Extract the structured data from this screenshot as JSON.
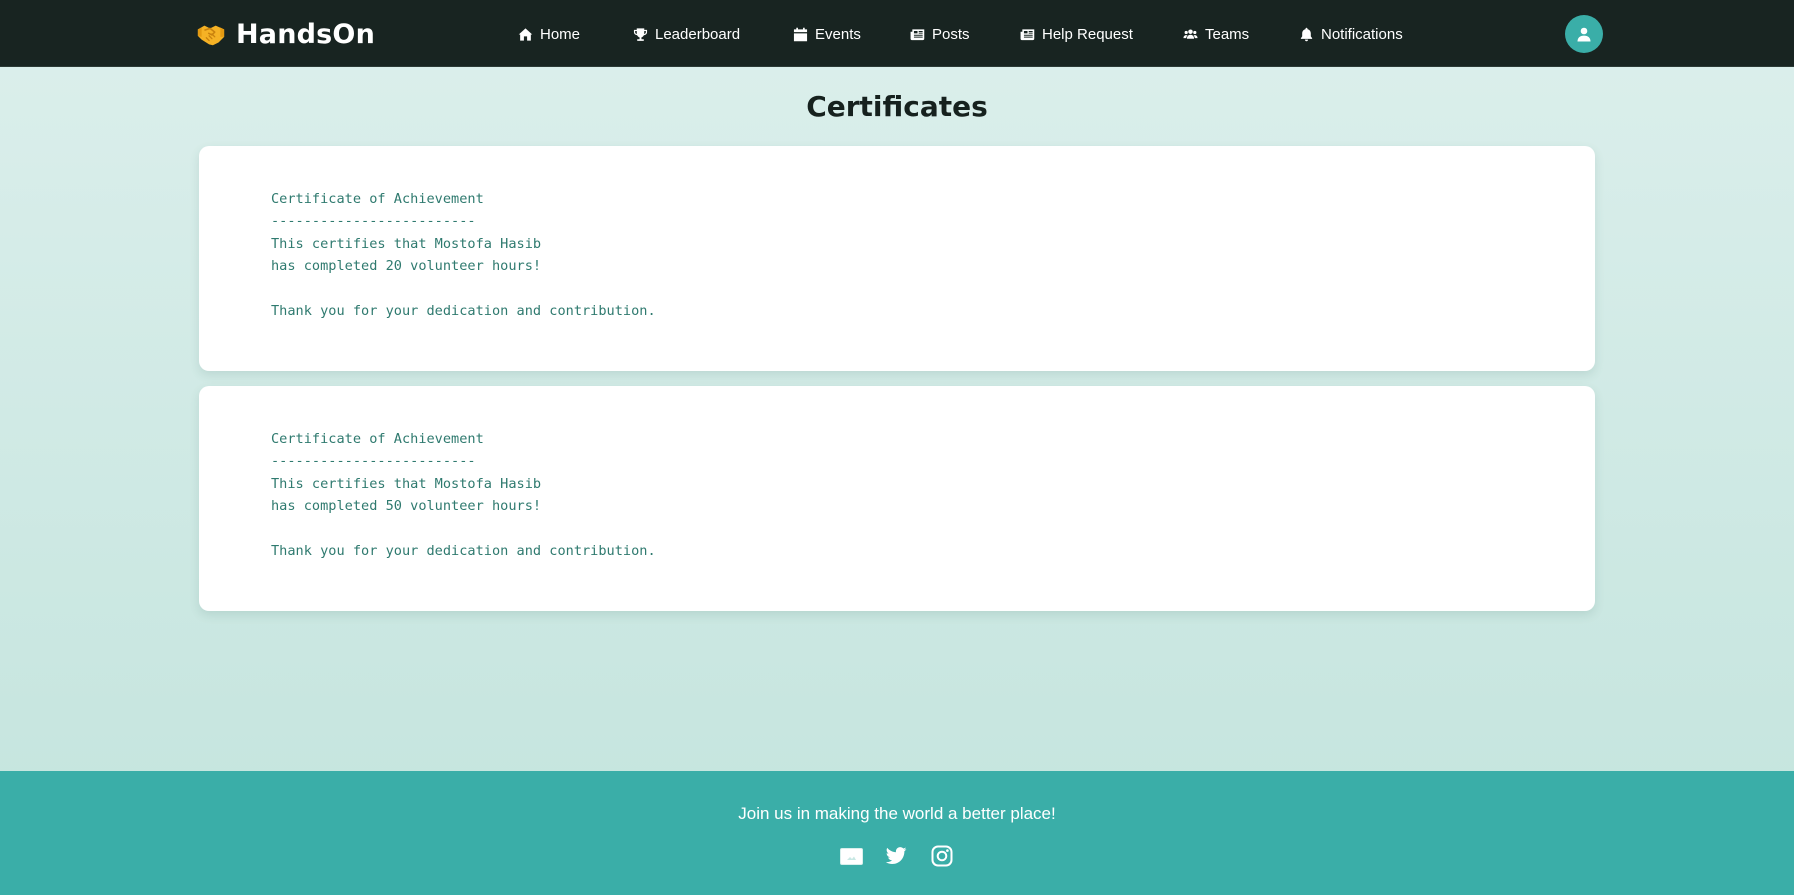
{
  "navbar": {
    "brand": "HandsOn",
    "items": [
      {
        "label": "Home",
        "icon": "home-icon"
      },
      {
        "label": "Leaderboard",
        "icon": "trophy-icon"
      },
      {
        "label": "Events",
        "icon": "calendar-icon"
      },
      {
        "label": "Posts",
        "icon": "newspaper-icon"
      },
      {
        "label": "Help Request",
        "icon": "newspaper-icon"
      },
      {
        "label": "Teams",
        "icon": "users-icon"
      },
      {
        "label": "Notifications",
        "icon": "bell-icon"
      }
    ],
    "avatar_icon": "user-icon"
  },
  "main": {
    "title": "Certificates",
    "certificates": [
      {
        "text": "Certificate of Achievement\n-------------------------\nThis certifies that Mostofa Hasib\nhas completed 20 volunteer hours!\n\nThank you for your dedication and contribution."
      },
      {
        "text": "Certificate of Achievement\n-------------------------\nThis certifies that Mostofa Hasib\nhas completed 50 volunteer hours!\n\nThank you for your dedication and contribution."
      }
    ]
  },
  "footer": {
    "tagline": "Join us in making the world a better place!",
    "social": [
      {
        "icon": "facebook-icon"
      },
      {
        "icon": "twitter-icon"
      },
      {
        "icon": "instagram-icon"
      }
    ]
  },
  "colors": {
    "navbar_bg": "#182421",
    "accent": "#3aaea8",
    "certificate_text": "#2f7a6f",
    "brand_icon": "#f5b225"
  }
}
